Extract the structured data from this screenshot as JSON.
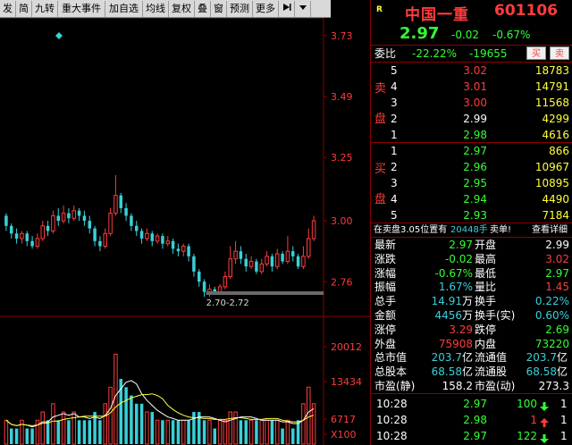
{
  "toolbar": {
    "items": [
      "发",
      "简",
      "九转",
      "重大事件",
      "加自选",
      "均线",
      "复权",
      "叠",
      "窗",
      "预测",
      "更多"
    ],
    "right_icons": [
      "play-icon",
      "dropdown-icon"
    ]
  },
  "chart": {
    "price_axis": [
      "3.73",
      "3.49",
      "3.25",
      "3.00",
      "2.76"
    ],
    "volume_axis": [
      "20012",
      "13434",
      "6717",
      "X100"
    ],
    "price_range_label": "2.70-2.72",
    "candles": [
      [
        3.02,
        2.98,
        3.03,
        2.96
      ],
      [
        2.98,
        2.95,
        2.99,
        2.93
      ],
      [
        2.95,
        2.93,
        2.97,
        2.91
      ],
      [
        2.93,
        2.95,
        2.96,
        2.91
      ],
      [
        2.95,
        2.92,
        2.96,
        2.9
      ],
      [
        2.92,
        2.9,
        2.94,
        2.89
      ],
      [
        2.9,
        2.93,
        2.95,
        2.89
      ],
      [
        2.93,
        2.98,
        3.0,
        2.92
      ],
      [
        2.98,
        2.96,
        3.0,
        2.94
      ],
      [
        2.96,
        3.02,
        3.04,
        2.95
      ],
      [
        3.02,
        3.0,
        3.05,
        2.98
      ],
      [
        3.0,
        3.03,
        3.06,
        2.99
      ],
      [
        3.03,
        3.01,
        3.05,
        2.99
      ],
      [
        3.01,
        3.04,
        3.06,
        3.0
      ],
      [
        3.04,
        3.02,
        3.05,
        3.0
      ],
      [
        3.02,
        3.0,
        3.04,
        2.98
      ],
      [
        3.0,
        2.97,
        3.02,
        2.95
      ],
      [
        2.97,
        2.92,
        2.98,
        2.9
      ],
      [
        2.92,
        2.9,
        2.94,
        2.88
      ],
      [
        2.9,
        2.95,
        2.97,
        2.89
      ],
      [
        2.95,
        3.03,
        3.05,
        2.94
      ],
      [
        3.03,
        3.1,
        3.18,
        3.02
      ],
      [
        3.1,
        3.05,
        3.11,
        3.03
      ],
      [
        3.05,
        3.02,
        3.07,
        3.0
      ],
      [
        3.02,
        2.98,
        3.03,
        2.96
      ],
      [
        2.98,
        2.96,
        3.0,
        2.94
      ],
      [
        2.96,
        2.93,
        2.97,
        2.91
      ],
      [
        2.93,
        2.95,
        2.97,
        2.92
      ],
      [
        2.95,
        2.92,
        2.96,
        2.9
      ],
      [
        2.92,
        2.94,
        2.95,
        2.91
      ],
      [
        2.94,
        2.91,
        2.95,
        2.89
      ],
      [
        2.91,
        2.92,
        2.94,
        2.9
      ],
      [
        2.92,
        2.89,
        2.93,
        2.87
      ],
      [
        2.89,
        2.88,
        2.91,
        2.86
      ],
      [
        2.88,
        2.9,
        2.91,
        2.86
      ],
      [
        2.9,
        2.86,
        2.91,
        2.84
      ],
      [
        2.86,
        2.8,
        2.87,
        2.78
      ],
      [
        2.8,
        2.76,
        2.81,
        2.74
      ],
      [
        2.76,
        2.72,
        2.77,
        2.7
      ],
      [
        2.72,
        2.73,
        2.75,
        2.7
      ],
      [
        2.73,
        2.72,
        2.74,
        2.71
      ],
      [
        2.72,
        2.74,
        2.75,
        2.71
      ],
      [
        2.74,
        2.78,
        2.8,
        2.73
      ],
      [
        2.78,
        2.85,
        2.9,
        2.77
      ],
      [
        2.85,
        2.88,
        2.92,
        2.83
      ],
      [
        2.88,
        2.85,
        2.9,
        2.83
      ],
      [
        2.85,
        2.82,
        2.87,
        2.8
      ],
      [
        2.82,
        2.84,
        2.86,
        2.81
      ],
      [
        2.84,
        2.8,
        2.85,
        2.79
      ],
      [
        2.8,
        2.83,
        2.85,
        2.79
      ],
      [
        2.83,
        2.86,
        2.88,
        2.82
      ],
      [
        2.86,
        2.82,
        2.87,
        2.8
      ],
      [
        2.82,
        2.87,
        2.89,
        2.81
      ],
      [
        2.87,
        2.84,
        2.88,
        2.83
      ],
      [
        2.84,
        2.88,
        2.94,
        2.83
      ],
      [
        2.88,
        2.86,
        2.9,
        2.84
      ],
      [
        2.86,
        2.82,
        2.87,
        2.81
      ],
      [
        2.82,
        2.86,
        2.9,
        2.81
      ],
      [
        2.86,
        2.93,
        2.97,
        2.85
      ],
      [
        2.93,
        3.0,
        3.02,
        2.92
      ]
    ],
    "volumes": [
      [
        3,
        1
      ],
      [
        2,
        0
      ],
      [
        2,
        0
      ],
      [
        3,
        1
      ],
      [
        2,
        0
      ],
      [
        2,
        0
      ],
      [
        3,
        1
      ],
      [
        4,
        1
      ],
      [
        3,
        0
      ],
      [
        5,
        1
      ],
      [
        3,
        0
      ],
      [
        4,
        1
      ],
      [
        3,
        0
      ],
      [
        4,
        1
      ],
      [
        3,
        0
      ],
      [
        3,
        0
      ],
      [
        3,
        0
      ],
      [
        4,
        0
      ],
      [
        3,
        0
      ],
      [
        5,
        1
      ],
      [
        7,
        1
      ],
      [
        11,
        1
      ],
      [
        8,
        0
      ],
      [
        7,
        0
      ],
      [
        6,
        0
      ],
      [
        5,
        0
      ],
      [
        5,
        0
      ],
      [
        4,
        1
      ],
      [
        4,
        0
      ],
      [
        3,
        1
      ],
      [
        3,
        0
      ],
      [
        3,
        1
      ],
      [
        3,
        0
      ],
      [
        3,
        0
      ],
      [
        3,
        1
      ],
      [
        3,
        0
      ],
      [
        4,
        0
      ],
      [
        4,
        0
      ],
      [
        3,
        0
      ],
      [
        3,
        1
      ],
      [
        2,
        0
      ],
      [
        3,
        1
      ],
      [
        3,
        1
      ],
      [
        4,
        1
      ],
      [
        4,
        1
      ],
      [
        3,
        0
      ],
      [
        3,
        0
      ],
      [
        3,
        1
      ],
      [
        3,
        0
      ],
      [
        3,
        1
      ],
      [
        3,
        1
      ],
      [
        3,
        0
      ],
      [
        3,
        1
      ],
      [
        2,
        0
      ],
      [
        3,
        1
      ],
      [
        2,
        0
      ],
      [
        3,
        0
      ],
      [
        5,
        1
      ],
      [
        7,
        1
      ],
      [
        5,
        1
      ]
    ]
  },
  "panel": {
    "name": "中国一重",
    "code": "601106",
    "badge": "R",
    "price": "2.97",
    "change": "-0.02",
    "change_pct": "-0.67%",
    "weibi_label": "委比",
    "weibi_pct": "-22.22%",
    "weibi_diff": "-19655",
    "buy_btn": "买",
    "sell_btn": "卖",
    "sell_side_label": "卖盘",
    "buy_side_label": "买盘",
    "asks": [
      {
        "lvl": "5",
        "price": "3.02",
        "vol": "18783"
      },
      {
        "lvl": "4",
        "price": "3.01",
        "vol": "14791"
      },
      {
        "lvl": "3",
        "price": "3.00",
        "vol": "11568"
      },
      {
        "lvl": "2",
        "price": "2.99",
        "vol": "4299"
      },
      {
        "lvl": "1",
        "price": "2.98",
        "vol": "4616"
      }
    ],
    "bids": [
      {
        "lvl": "1",
        "price": "2.97",
        "vol": "866"
      },
      {
        "lvl": "2",
        "price": "2.96",
        "vol": "10967"
      },
      {
        "lvl": "3",
        "price": "2.95",
        "vol": "10895"
      },
      {
        "lvl": "4",
        "price": "2.94",
        "vol": "4490"
      },
      {
        "lvl": "5",
        "price": "2.93",
        "vol": "7184"
      }
    ],
    "notice": "在卖盘3.05位置有",
    "notice_qty": "20448手",
    "notice_action": "卖单!",
    "notice_link": "查看详细",
    "stats": [
      {
        "l": "最新",
        "v": "2.97",
        "vc": "green",
        "r": "开盘",
        "rv": "2.99",
        "rvc": "white"
      },
      {
        "l": "涨跌",
        "v": "-0.02",
        "vc": "green",
        "r": "最高",
        "rv": "3.02",
        "rvc": "red"
      },
      {
        "l": "涨幅",
        "v": "-0.67%",
        "vc": "green",
        "r": "最低",
        "rv": "2.97",
        "rvc": "green"
      },
      {
        "l": "振幅",
        "v": "1.67%",
        "vc": "cyan",
        "r": "量比",
        "rv": "1.45",
        "rvc": "red"
      },
      {
        "l": "总手",
        "v": "14.91",
        "vu": "万",
        "vc": "cyan",
        "r": "换手",
        "rv": "0.22%",
        "rvc": "cyan"
      },
      {
        "l": "金额",
        "v": "4456",
        "vu": "万",
        "vc": "cyan",
        "r": "换手(实)",
        "rv": "0.60%",
        "rvc": "cyan"
      },
      {
        "l": "涨停",
        "v": "3.29",
        "vc": "red",
        "r": "跌停",
        "rv": "2.69",
        "rvc": "green"
      },
      {
        "l": "外盘",
        "v": "75908",
        "vc": "red",
        "r": "内盘",
        "rv": "73220",
        "rvc": "green"
      },
      {
        "l": "总市值",
        "v": "203.7",
        "vu": "亿",
        "vc": "cyan",
        "r": "流通值",
        "rv": "203.7",
        "rvu": "亿",
        "rvc": "cyan"
      },
      {
        "l": "总股本",
        "v": "68.58",
        "vu": "亿",
        "vc": "cyan",
        "r": "流通股",
        "rv": "68.58",
        "rvu": "亿",
        "rvc": "cyan"
      },
      {
        "l": "市盈(静)",
        "v": "158.2",
        "vc": "white",
        "r": "市盈(动)",
        "rv": "273.3",
        "rvc": "white"
      }
    ],
    "ticks": [
      {
        "t": "10:28",
        "p": "2.97",
        "pc": "green",
        "v": "100",
        "dir": "down",
        "n": "1"
      },
      {
        "t": "10:28",
        "p": "2.98",
        "pc": "green",
        "v": "1",
        "dir": "up",
        "n": "1"
      },
      {
        "t": "10:28",
        "p": "2.97",
        "pc": "green",
        "v": "122",
        "dir": "down",
        "n": "1"
      }
    ],
    "colors": {
      "up": "#ff3c3c",
      "down": "#34ff34",
      "cyan": "#39d0d8",
      "frame": "#8a0000"
    }
  }
}
